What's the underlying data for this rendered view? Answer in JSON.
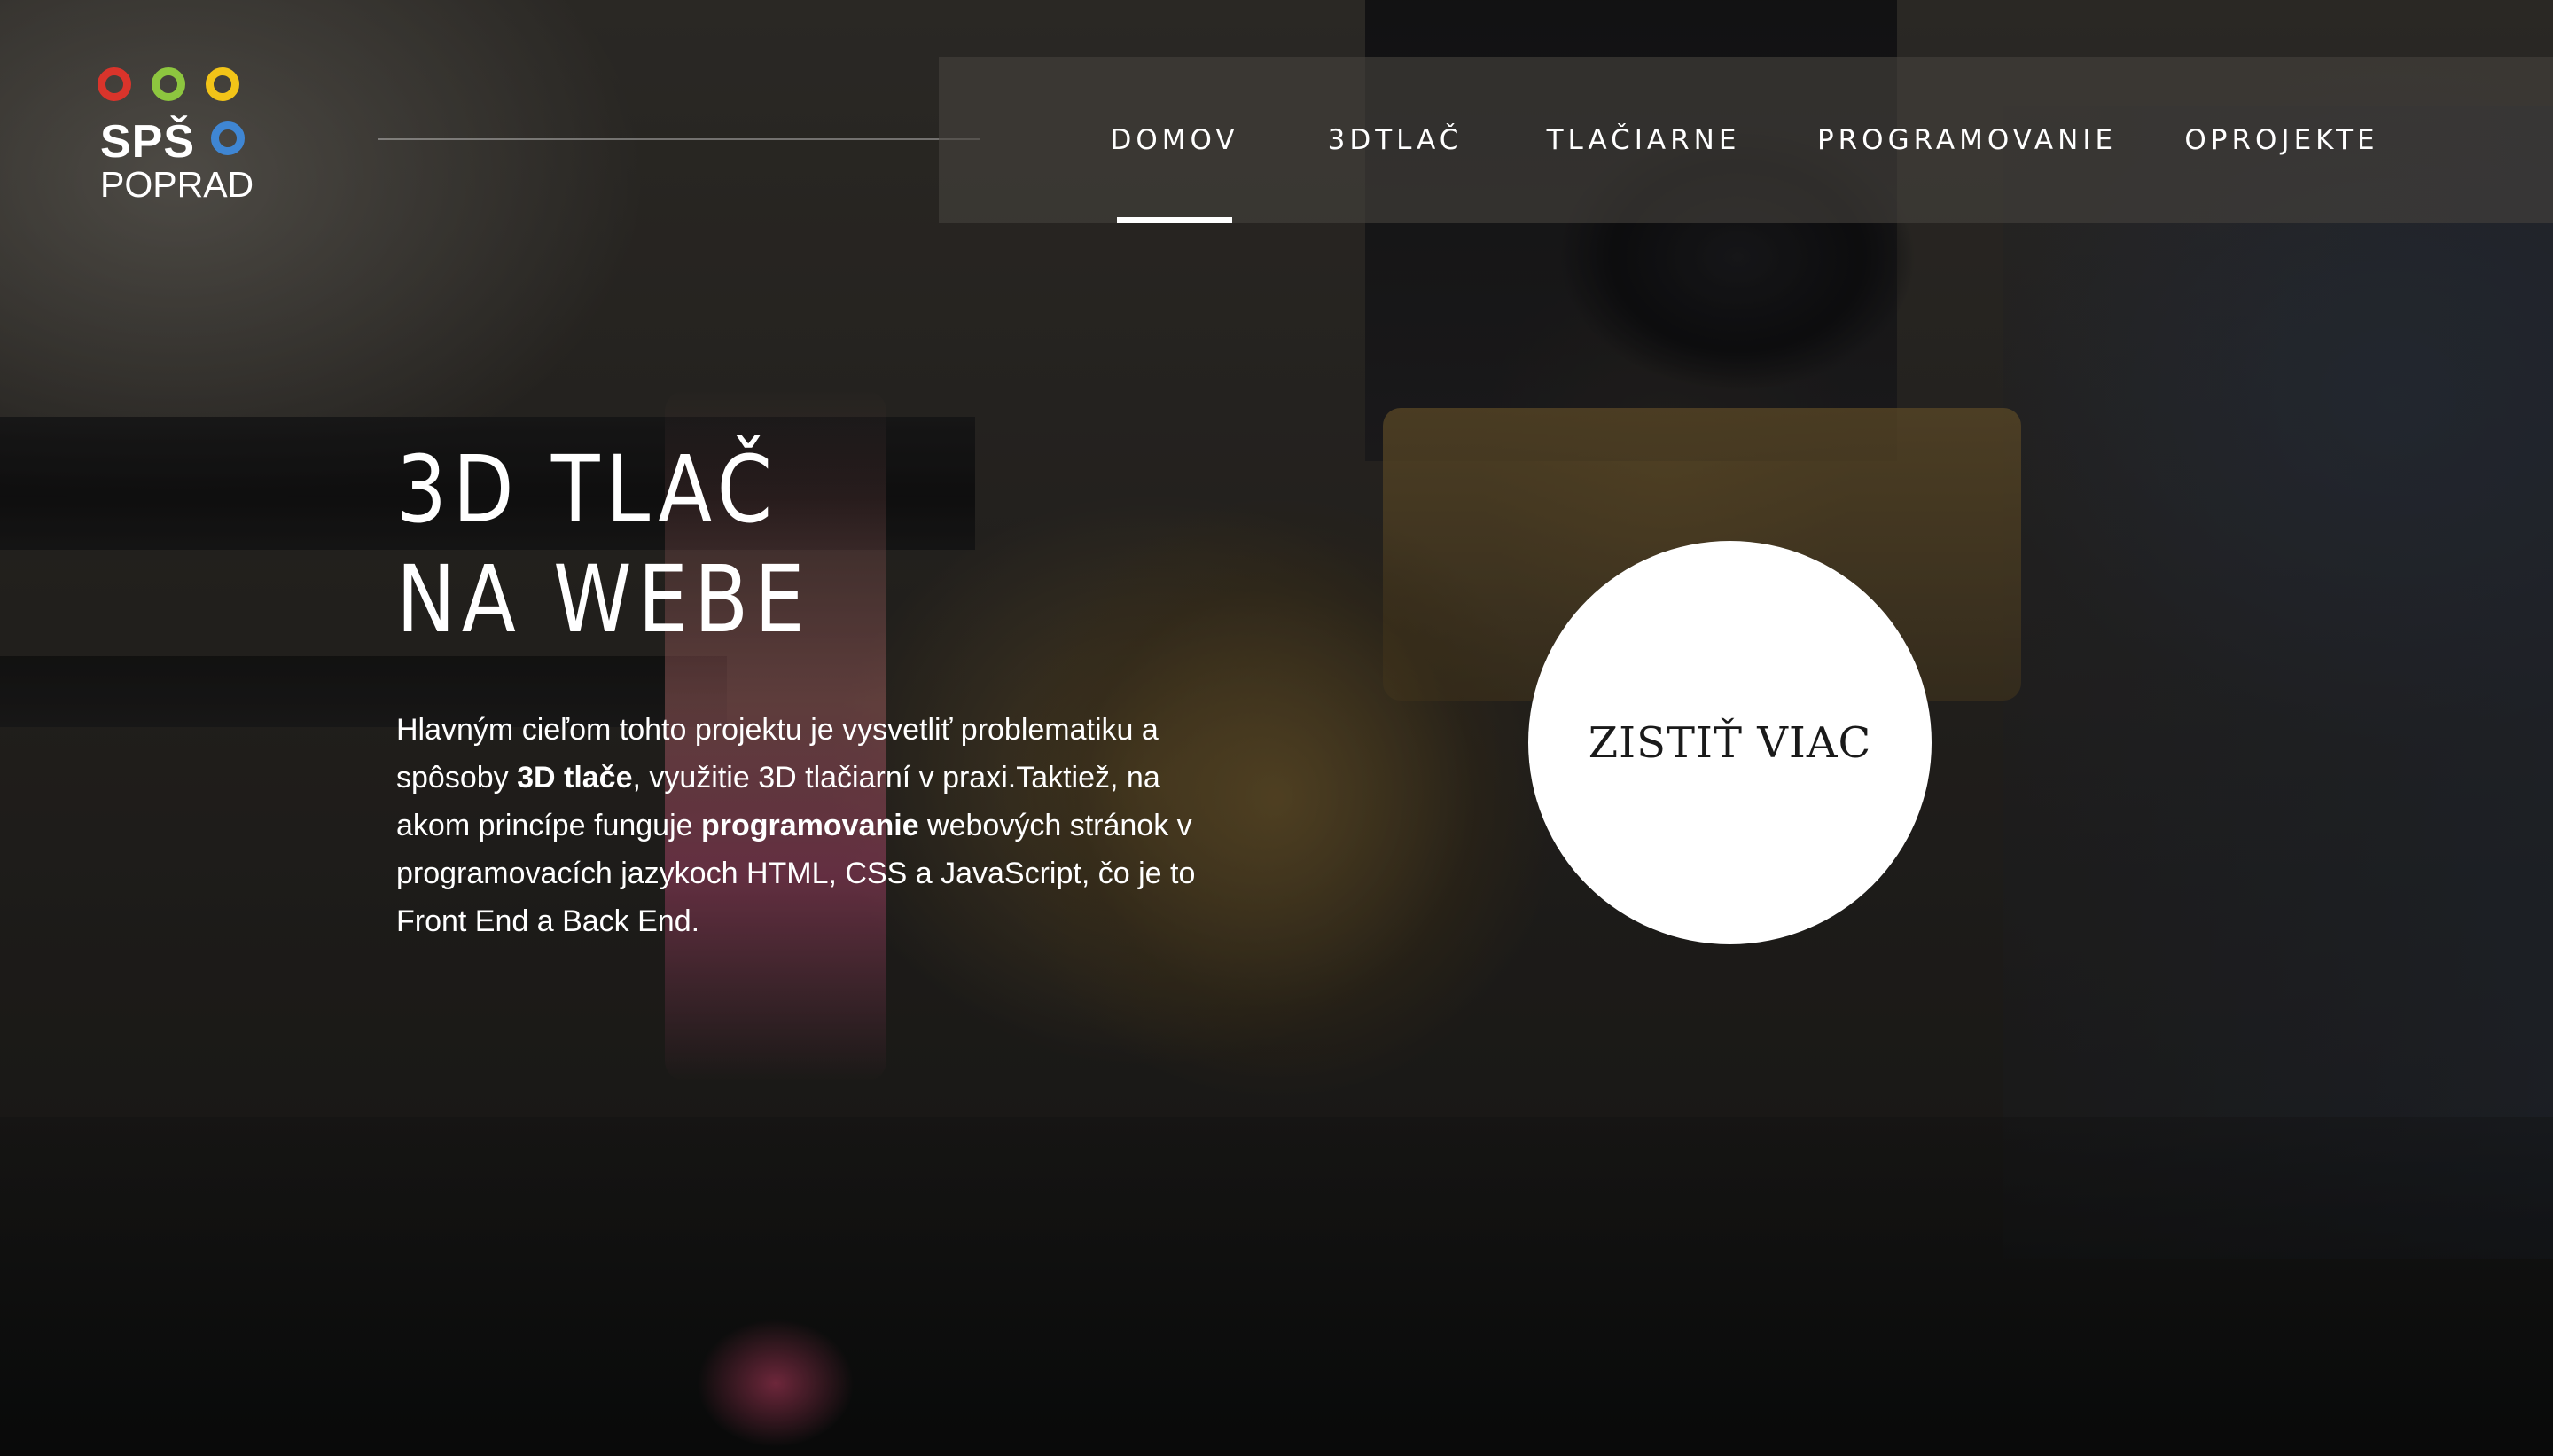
{
  "logo": {
    "circle_colors": [
      "#d9342b",
      "#8dc63f",
      "#f2c418",
      "#3f86d3"
    ],
    "line1": "SPŠ",
    "line2": "POPRAD"
  },
  "nav": {
    "items": [
      {
        "label": "DOMOV",
        "active": true
      },
      {
        "label": "3DTLAČ",
        "active": false
      },
      {
        "label": "TLAČIARNE",
        "active": false
      },
      {
        "label": "PROGRAMOVANIE",
        "active": false
      },
      {
        "label": "OPROJEKTE",
        "active": false
      }
    ]
  },
  "hero": {
    "title_line1": "3D TLAČ",
    "title_line2": "NA WEBE",
    "desc_part1": "Hlavným cieľom tohto projektu je vysvetliť problematiku a spôsoby ",
    "desc_bold1": "3D tlače",
    "desc_part2": ", využitie 3D tlačiarní v praxi.Taktiež, na akom princípe funguje ",
    "desc_bold2": "programovanie",
    "desc_part3": " webových stránok v programovacích jazykoch HTML, CSS a JavaScript, čo je to Front End a Back End.",
    "cta_label": "ZISTIŤ VIAC"
  }
}
